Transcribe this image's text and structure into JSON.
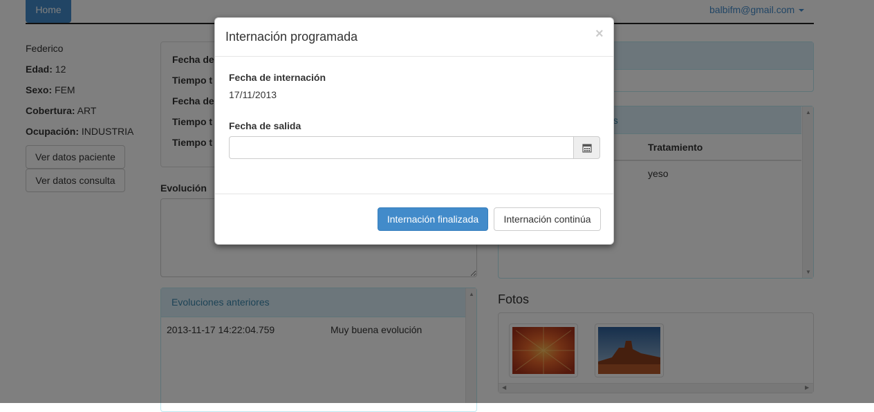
{
  "nav": {
    "home_label": "Home",
    "user_email": "balbifm@gmail.com"
  },
  "patient": {
    "name": "Federico",
    "age_label": "Edad:",
    "age_value": " 12",
    "sex_label": "Sexo:",
    "sex_value": " FEM",
    "coverage_label": "Cobertura:",
    "coverage_value": " ART",
    "occupation_label": "Ocupación:",
    "occupation_value": " INDUSTRIA",
    "btn_patient": "Ver datos paciente",
    "btn_consult": "Ver datos consulta"
  },
  "summary_panel": {
    "labels": [
      "Fecha de",
      "Tiempo t",
      "Fecha de",
      "Tiempo t",
      "Tiempo t"
    ]
  },
  "evolution": {
    "label": "Evolución"
  },
  "prev_evolutions": {
    "title": "Evoluciones anteriores",
    "rows": [
      {
        "date": "2013-11-17 14:22:04.759",
        "text": "Muy buena evolución"
      }
    ]
  },
  "right_panel": {
    "heading_partial": "os",
    "column": "Tratamiento",
    "rows": [
      "yeso"
    ]
  },
  "photos": {
    "title": "Fotos"
  },
  "modal": {
    "title": "Internación programada",
    "close": "×",
    "admission_label": "Fecha de internación",
    "admission_value": "17/11/2013",
    "exit_label": "Fecha de salida",
    "exit_value": "",
    "btn_finished": "Internación finalizada",
    "btn_continue": "Internación continúa"
  }
}
